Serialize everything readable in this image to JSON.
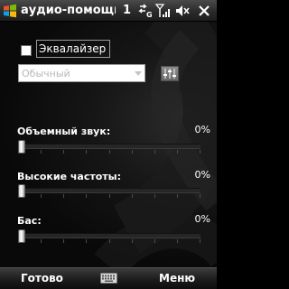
{
  "titlebar": {
    "title": "аудио-помощник",
    "notification_count": "1",
    "icons": [
      "windows-start-icon",
      "data-connection-icon",
      "signal-strength-icon",
      "volume-muted-icon",
      "close-icon"
    ]
  },
  "equalizer": {
    "checked": false,
    "label": "Эквалайзер",
    "preset_value": "Обычный",
    "preset_enabled": false,
    "settings_icon": "equalizer-sliders-icon"
  },
  "sliders": [
    {
      "label": "Объемный звук:",
      "value_text": "0%",
      "value": 0
    },
    {
      "label": "Высокие частоты:",
      "value_text": "0%",
      "value": 0
    },
    {
      "label": "Бас:",
      "value_text": "0%",
      "value": 0
    }
  ],
  "menubar": {
    "left_label": "Готово",
    "right_label": "Меню",
    "center_icon": "keyboard-icon"
  },
  "colors": {
    "background": "#0a0a0a",
    "text": "#ffffff",
    "disabled_text": "#b8b8b8",
    "track": "#262626"
  }
}
